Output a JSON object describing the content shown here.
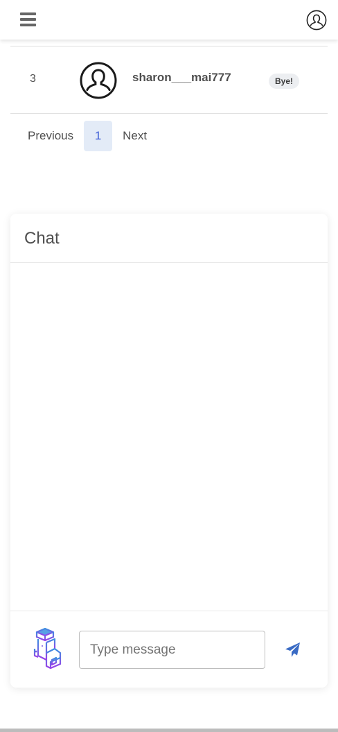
{
  "topbar": {
    "menu_icon": "hamburger-menu-icon",
    "profile_icon": "user-circle-icon"
  },
  "leaderboard": {
    "rows": [
      {
        "rank": "3",
        "avatar_icon": "user-avatar-icon",
        "username": "sharon___mai777",
        "badge": "Bye!"
      }
    ]
  },
  "pagination": {
    "previous": "Previous",
    "current": "1",
    "next": "Next"
  },
  "chat": {
    "title": "Chat",
    "input_placeholder": "Type message",
    "input_value": "",
    "bot_icon": "bot-avatar-icon",
    "send_icon": "paper-plane-send-icon",
    "accent_color": "#3a6bc4"
  }
}
